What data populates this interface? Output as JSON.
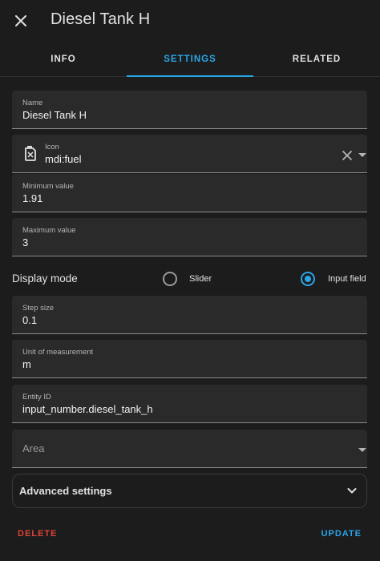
{
  "header": {
    "title": "Diesel Tank H"
  },
  "tabs": [
    {
      "label": "INFO"
    },
    {
      "label": "SETTINGS"
    },
    {
      "label": "RELATED"
    }
  ],
  "fields": {
    "name": {
      "label": "Name",
      "value": "Diesel Tank H"
    },
    "icon": {
      "label": "Icon",
      "value": "mdi:fuel",
      "icon_name": "fuel-icon"
    },
    "minimum": {
      "label": "Minimum value",
      "value": "1.91"
    },
    "maximum": {
      "label": "Maximum value",
      "value": "3"
    },
    "step": {
      "label": "Step size",
      "value": "0.1"
    },
    "unit": {
      "label": "Unit of measurement",
      "value": "m"
    },
    "entity_id": {
      "label": "Entity ID",
      "value": "input_number.diesel_tank_h"
    },
    "area": {
      "placeholder": "Area"
    }
  },
  "display_mode": {
    "label": "Display mode",
    "options": [
      {
        "label": "Slider",
        "selected": false
      },
      {
        "label": "Input field",
        "selected": true
      }
    ]
  },
  "advanced": {
    "label": "Advanced settings"
  },
  "footer": {
    "delete_label": "DELETE",
    "update_label": "UPDATE"
  },
  "colors": {
    "accent": "#29a5e8",
    "danger": "#db4437",
    "background": "#1c1c1c",
    "field_bg": "#2a2a2a"
  }
}
